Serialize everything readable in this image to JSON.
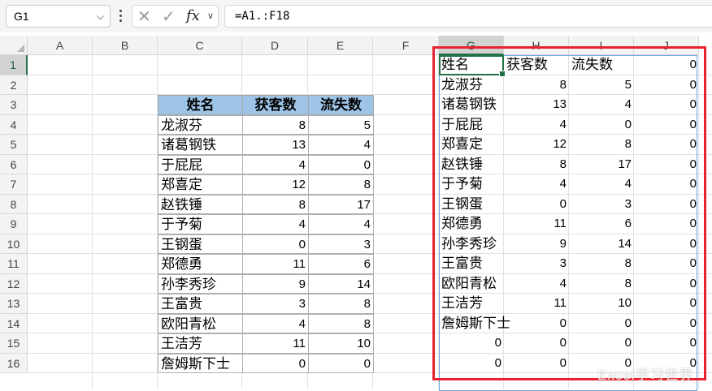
{
  "formula_bar": {
    "name_box": "G1",
    "formula": "=A1.:F18",
    "cancel_icon": "✕",
    "enter_icon": "✓",
    "fx_label": "fx"
  },
  "columns": [
    "A",
    "B",
    "C",
    "D",
    "E",
    "F",
    "G",
    "H",
    "I",
    "J"
  ],
  "rows": [
    "1",
    "2",
    "3",
    "4",
    "5",
    "6",
    "7",
    "8",
    "9",
    "10",
    "11",
    "12",
    "13",
    "14",
    "15",
    "16"
  ],
  "selected_column": "G",
  "selected_row": "1",
  "source_table": {
    "headers": [
      "姓名",
      "获客数",
      "流失数"
    ],
    "rows": [
      [
        "龙淑芬",
        "8",
        "5"
      ],
      [
        "诸葛钢铁",
        "13",
        "4"
      ],
      [
        "于屁屁",
        "4",
        "0"
      ],
      [
        "郑喜定",
        "12",
        "8"
      ],
      [
        "赵铁锤",
        "8",
        "17"
      ],
      [
        "于予菊",
        "4",
        "4"
      ],
      [
        "王钢蛋",
        "0",
        "3"
      ],
      [
        "郑德勇",
        "11",
        "6"
      ],
      [
        "孙李秀珍",
        "9",
        "14"
      ],
      [
        "王富贵",
        "3",
        "8"
      ],
      [
        "欧阳青松",
        "4",
        "8"
      ],
      [
        "王洁芳",
        "11",
        "10"
      ],
      [
        "詹姆斯下士",
        "0",
        "0"
      ]
    ]
  },
  "spill_result": {
    "rows": [
      [
        "姓名",
        "获客数",
        "流失数",
        "0"
      ],
      [
        "龙淑芬",
        "8",
        "5",
        "0"
      ],
      [
        "诸葛钢铁",
        "13",
        "4",
        "0"
      ],
      [
        "于屁屁",
        "4",
        "0",
        "0"
      ],
      [
        "郑喜定",
        "12",
        "8",
        "0"
      ],
      [
        "赵铁锤",
        "8",
        "17",
        "0"
      ],
      [
        "于予菊",
        "4",
        "4",
        "0"
      ],
      [
        "王钢蛋",
        "0",
        "3",
        "0"
      ],
      [
        "郑德勇",
        "11",
        "6",
        "0"
      ],
      [
        "孙李秀珍",
        "9",
        "14",
        "0"
      ],
      [
        "王富贵",
        "3",
        "8",
        "0"
      ],
      [
        "欧阳青松",
        "4",
        "8",
        "0"
      ],
      [
        "王洁芳",
        "11",
        "10",
        "0"
      ],
      [
        "詹姆斯下士",
        "0",
        "0",
        "0"
      ],
      [
        "0",
        "0",
        "0",
        "0"
      ],
      [
        "0",
        "0",
        "0",
        "0"
      ]
    ]
  },
  "colors": {
    "header_fill": "#9dc3e6",
    "highlight_frame": "#e8232f",
    "selection": "#217346"
  },
  "watermark": "Excel学习世界"
}
